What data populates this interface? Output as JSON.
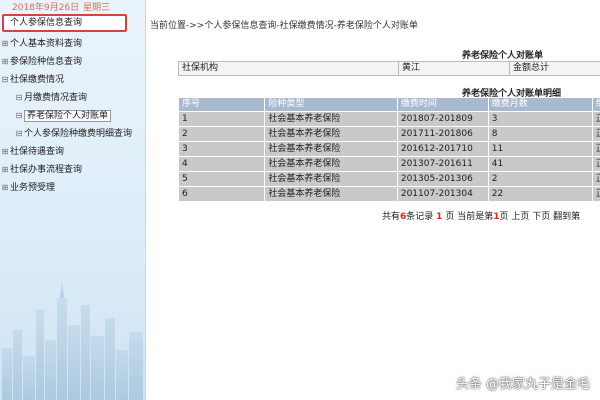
{
  "sidebar": {
    "date": "2018年9月26日",
    "weekday": "星期三",
    "items": [
      {
        "label": "个人参保信息查询",
        "marker": ""
      },
      {
        "label": "个人基本资料查询",
        "marker": "⊞"
      },
      {
        "label": "参保险种信息查询",
        "marker": "⊞"
      },
      {
        "label": "社保缴费情况",
        "marker": "⊟"
      },
      {
        "label": "月缴费情况查询",
        "marker": "⊟"
      },
      {
        "label": "养老保险个人对账单",
        "marker": "⊟"
      },
      {
        "label": "个人参保险种缴费明细查询",
        "marker": "⊟"
      },
      {
        "label": "社保待遇查询",
        "marker": "⊞"
      },
      {
        "label": "社保办事流程查询",
        "marker": "⊞"
      },
      {
        "label": "业务预受理",
        "marker": "⊞"
      }
    ]
  },
  "main": {
    "breadcrumb": "当前位置->>个人参保信息查询-社保缴费情况-养老保险个人对账单",
    "summary_title": "养老保险个人对账单",
    "summary": {
      "label1": "社保机构",
      "value1": "黄江",
      "label2": "金额总计"
    },
    "detail_title": "养老保险个人对账单明细",
    "detail": {
      "headers": [
        "序号",
        "险种类型",
        "缴费时间",
        "缴费月数",
        "缴费"
      ],
      "rows": [
        [
          "1",
          "社会基本养老保险",
          "201807-201809",
          "3",
          "正常"
        ],
        [
          "2",
          "社会基本养老保险",
          "201711-201806",
          "8",
          "正常"
        ],
        [
          "3",
          "社会基本养老保险",
          "201612-201710",
          "11",
          "正常"
        ],
        [
          "4",
          "社会基本养老保险",
          "201307-201611",
          "41",
          "正常"
        ],
        [
          "5",
          "社会基本养老保险",
          "201305-201306",
          "2",
          "正常"
        ],
        [
          "6",
          "社会基本养老保险",
          "201107-201304",
          "22",
          "正常"
        ]
      ]
    },
    "pager": {
      "t1": "共有",
      "total": "6",
      "t2": "条记录",
      "pages": "1",
      "t3": "页",
      "t4": "当前是第",
      "current": "1",
      "t5": "页",
      "first": "上页",
      "prev": "下页",
      "next": "翻到第"
    }
  },
  "watermark": "头条 @我家丸子是金毛"
}
